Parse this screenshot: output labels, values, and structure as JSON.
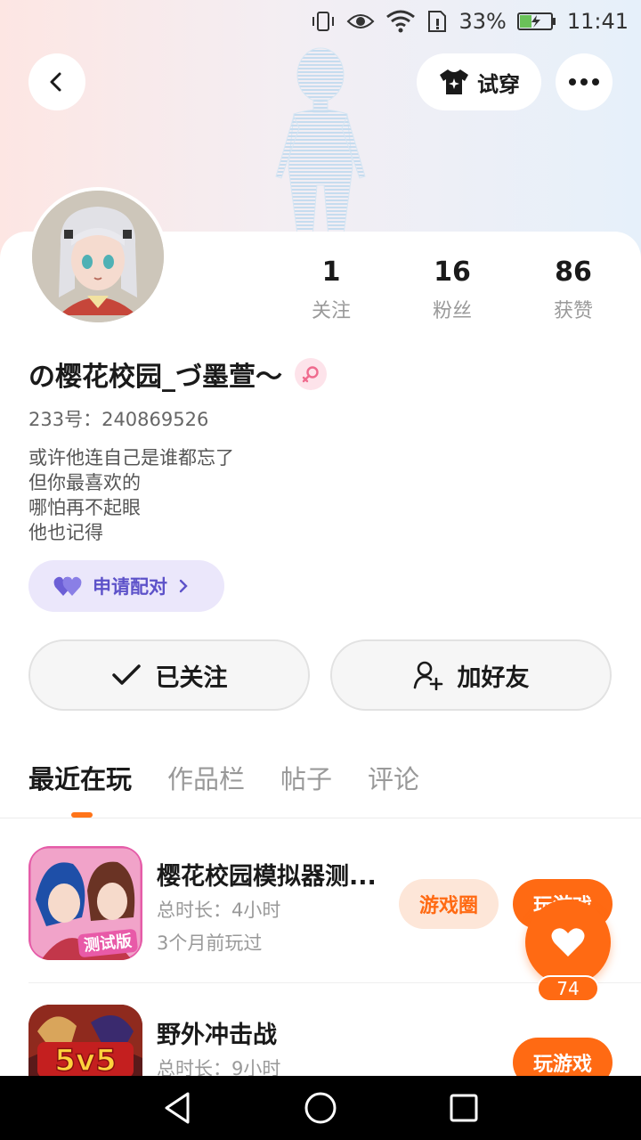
{
  "status_bar": {
    "battery_percent": "33%",
    "time": "11:41"
  },
  "header": {
    "tryon_label": "试穿"
  },
  "profile": {
    "stats": [
      {
        "value": "1",
        "label": "关注"
      },
      {
        "value": "16",
        "label": "粉丝"
      },
      {
        "value": "86",
        "label": "获赞"
      }
    ],
    "username": "の樱花校园_づ墨萱～",
    "uid": "233号：240869526",
    "bio_lines": [
      "或许他连自己是谁都忘了",
      "但你最喜欢的",
      "哪怕再不起眼",
      "他也记得"
    ],
    "match_label": "申请配对"
  },
  "actions": {
    "followed_label": "已关注",
    "add_friend_label": "加好友"
  },
  "tabs": [
    "最近在玩",
    "作品栏",
    "帖子",
    "评论"
  ],
  "games": [
    {
      "title": "樱花校园模拟器测...",
      "duration": "总时长：4小时",
      "last_played": "3个月前玩过",
      "circle_label": "游戏圈",
      "play_label": "玩游戏"
    },
    {
      "title": "野外冲击战",
      "duration": "总时长：9小时",
      "play_label": "玩游戏"
    }
  ],
  "game_icon_texts": [
    "测试版",
    "5v5"
  ],
  "like_count": "74",
  "colors": {
    "accent": "#ff6a13",
    "match_bg": "#ebe7fb",
    "match_text": "#5d52c9",
    "circle_chip_bg": "#fde6d8",
    "circle_chip_text": "#ff6a13"
  }
}
